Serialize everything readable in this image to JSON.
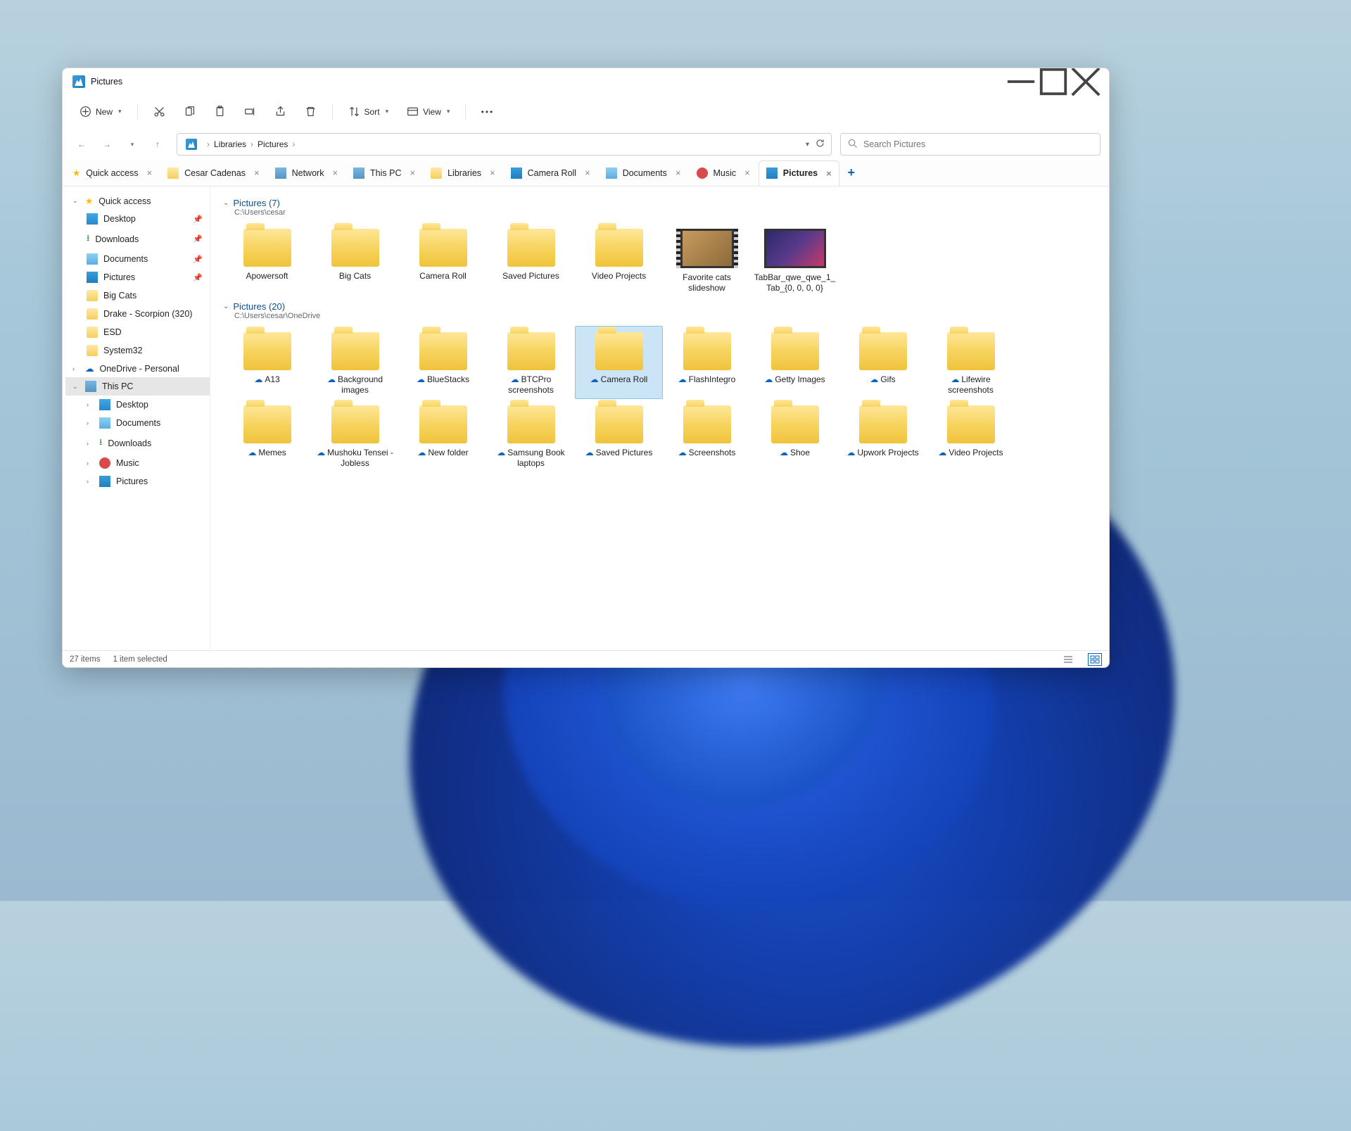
{
  "window": {
    "title": "Pictures"
  },
  "toolbar": {
    "new": "New",
    "sort": "Sort",
    "view": "View"
  },
  "breadcrumb": [
    "Libraries",
    "Pictures"
  ],
  "search": {
    "placeholder": "Search Pictures"
  },
  "tabs": [
    {
      "label": "Quick access",
      "icon": "star"
    },
    {
      "label": "Cesar Cadenas",
      "icon": "folder"
    },
    {
      "label": "Network",
      "icon": "network"
    },
    {
      "label": "This PC",
      "icon": "pc"
    },
    {
      "label": "Libraries",
      "icon": "folder"
    },
    {
      "label": "Camera Roll",
      "icon": "pic"
    },
    {
      "label": "Documents",
      "icon": "doc"
    },
    {
      "label": "Music",
      "icon": "music"
    },
    {
      "label": "Pictures",
      "icon": "pic",
      "active": true
    }
  ],
  "sidebar": {
    "quick_access": "Quick access",
    "quick_items": [
      {
        "label": "Desktop",
        "icon": "desk",
        "pin": true
      },
      {
        "label": "Downloads",
        "icon": "dl",
        "pin": true
      },
      {
        "label": "Documents",
        "icon": "doc",
        "pin": true
      },
      {
        "label": "Pictures",
        "icon": "pic",
        "pin": true
      },
      {
        "label": "Big Cats",
        "icon": "folder"
      },
      {
        "label": "Drake - Scorpion (320)",
        "icon": "folder"
      },
      {
        "label": "ESD",
        "icon": "folder"
      },
      {
        "label": "System32",
        "icon": "folder"
      }
    ],
    "onedrive": "OneDrive - Personal",
    "thispc": "This PC",
    "thispc_items": [
      {
        "label": "Desktop",
        "icon": "desk"
      },
      {
        "label": "Documents",
        "icon": "doc"
      },
      {
        "label": "Downloads",
        "icon": "dl"
      },
      {
        "label": "Music",
        "icon": "music"
      },
      {
        "label": "Pictures",
        "icon": "pic"
      }
    ]
  },
  "groups": [
    {
      "title": "Pictures (7)",
      "sub": "C:\\Users\\cesar",
      "items": [
        {
          "label": "Apowersoft",
          "type": "folder"
        },
        {
          "label": "Big Cats",
          "type": "folder"
        },
        {
          "label": "Camera Roll",
          "type": "folder"
        },
        {
          "label": "Saved Pictures",
          "type": "folder"
        },
        {
          "label": "Video Projects",
          "type": "folder"
        },
        {
          "label": "Favorite cats slideshow",
          "type": "film"
        },
        {
          "label": "TabBar_qwe_qwe_1_Tab_{0, 0, 0, 0}",
          "type": "image"
        }
      ]
    },
    {
      "title": "Pictures (20)",
      "sub": "C:\\Users\\cesar\\OneDrive",
      "items": [
        {
          "label": "A13",
          "type": "folder",
          "cloud": true
        },
        {
          "label": "Background images",
          "type": "folder",
          "cloud": true
        },
        {
          "label": "BlueStacks",
          "type": "folder",
          "cloud": true
        },
        {
          "label": "BTCPro screenshots",
          "type": "folder",
          "cloud": true
        },
        {
          "label": "Camera Roll",
          "type": "folder",
          "cloud": true,
          "selected": true
        },
        {
          "label": "FlashIntegro",
          "type": "folder",
          "cloud": true
        },
        {
          "label": "Getty Images",
          "type": "folder",
          "cloud": true
        },
        {
          "label": "Gifs",
          "type": "folder",
          "cloud": true
        },
        {
          "label": "Lifewire screenshots",
          "type": "folder",
          "cloud": true
        },
        {
          "label": "Memes",
          "type": "folder",
          "cloud": true
        },
        {
          "label": "Mushoku Tensei - Jobless",
          "type": "folder",
          "cloud": true
        },
        {
          "label": "New folder",
          "type": "folder",
          "cloud": true
        },
        {
          "label": "Samsung Book laptops",
          "type": "folder",
          "cloud": true
        },
        {
          "label": "Saved Pictures",
          "type": "folder",
          "cloud": true
        },
        {
          "label": "Screenshots",
          "type": "folder",
          "cloud": true
        },
        {
          "label": "Shoe",
          "type": "folder",
          "cloud": true
        },
        {
          "label": "Upwork Projects",
          "type": "folder",
          "cloud": true
        },
        {
          "label": "Video Projects",
          "type": "folder",
          "cloud": true
        }
      ]
    }
  ],
  "status": {
    "count": "27 items",
    "selected": "1 item selected"
  }
}
